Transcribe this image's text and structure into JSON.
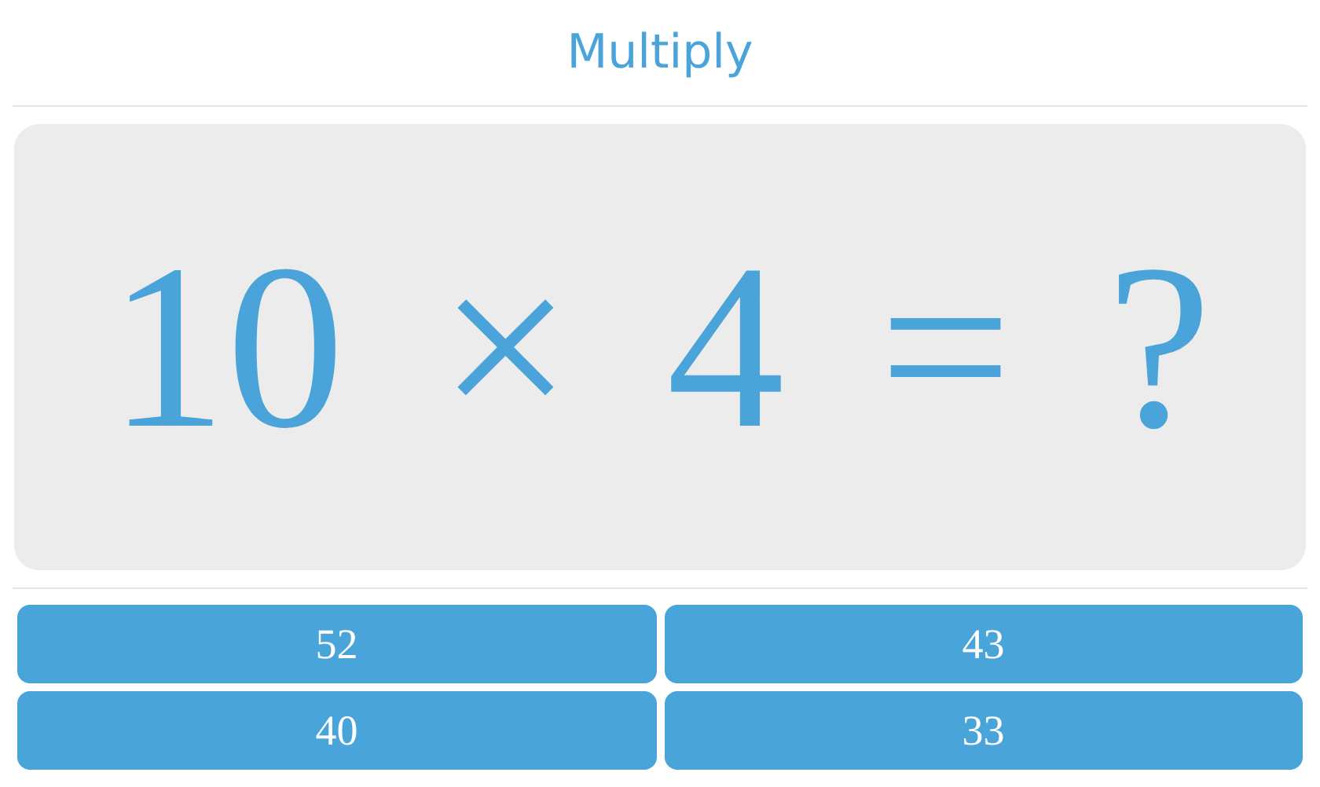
{
  "title": "Multiply",
  "question": {
    "terms": [
      "10",
      "×",
      "4",
      "=",
      "?"
    ]
  },
  "answers": [
    "52",
    "43",
    "40",
    "33"
  ]
}
